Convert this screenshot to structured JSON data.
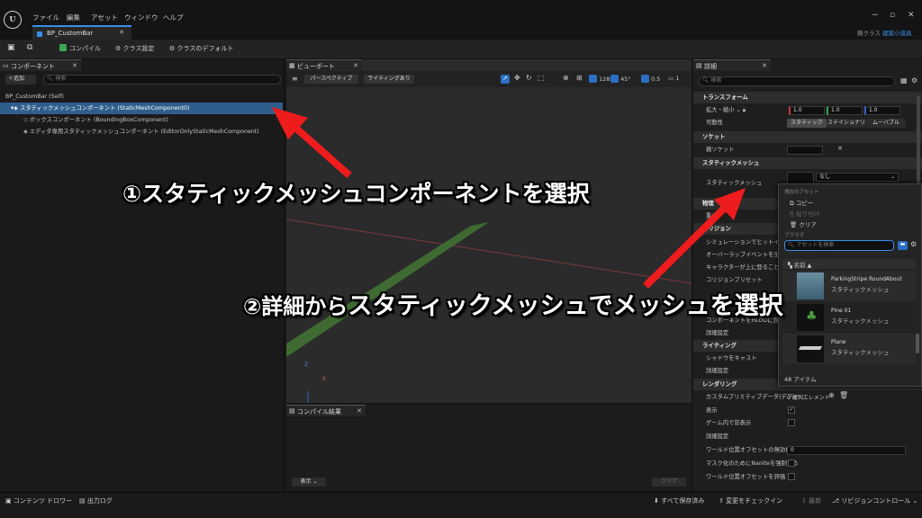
{
  "app": {
    "logo": "U",
    "menu": [
      "ファイル",
      "編集",
      "アセット",
      "ウィンドウ",
      "ヘルプ"
    ],
    "tab": "BP_CustomBar",
    "parent_label": "親クラス",
    "parent_value": "建築小道具",
    "window_controls": {
      "min": "−",
      "max": "▫",
      "close": "✕"
    }
  },
  "toolbar": {
    "compile": "コンパイル",
    "class_settings": "クラス設定",
    "class_defaults": "クラスのデフォルト"
  },
  "components": {
    "tab": "コンポーネント",
    "add": "＋追加",
    "search_placeholder": "検索",
    "tree": [
      "BP_CustomBar (Self)",
      "スタティックメッシュコンポーネント (StaticMeshComponent0)",
      "ボックスコンポーネント (BoundingBoxComponent)",
      "エディタ専用スタティックメッシュコンポーネント (EditorOnlyStaticMeshComponent)"
    ]
  },
  "viewport": {
    "tab": "ビューポート",
    "perspective": "パースペクティブ",
    "lit": "ライティングあり",
    "grid": "128",
    "angle": "45°",
    "scale": "0.5",
    "cam": "1",
    "axis_z": "Z",
    "axis_x": "X"
  },
  "compile_results": {
    "tab": "コンパイル結果",
    "show": "表示 ⌄",
    "clear": "クリア"
  },
  "details": {
    "tab": "詳細",
    "search_placeholder": "検索",
    "transform": "トランスフォーム",
    "scale_label": "拡大・縮小 ⌄",
    "scale_x": "1.0",
    "scale_y": "1.0",
    "scale_z": "1.0",
    "mobility": "可動性",
    "mob_static": "スタティック",
    "mob_stationary": "ステイショナリ",
    "mob_movable": "ムーバブル",
    "socket": "ソケット",
    "parent_socket": "親ソケット",
    "static_mesh_cat": "スタティックメッシュ",
    "static_mesh": "スタティックメッシュ",
    "static_mesh_value": "なし",
    "physics": "物理",
    "physics_sub": "重力",
    "collision": "コリジョン",
    "sim_hit": "シミュレーションでヒットイベント",
    "overlap": "オーバーラップイベントを生成",
    "char_step": "キャラクターが上に登ることがで…",
    "collision_preset": "コリジョンプリセット",
    "hlod": "コンポーネントをHLODに含める",
    "adv1": "詳細設定",
    "lighting": "ライティング",
    "cast_shadow": "シャドウをキャスト",
    "adv2": "詳細設定",
    "rendering": "レンダリング",
    "custom_prim": "カスタムプリミティブデータ(デフォ…",
    "custom_prim_val": "0 配列エレメント",
    "visible": "表示",
    "hidden_game": "ゲーム内で非表示",
    "adv3": "詳細設定",
    "wpo": "ワールド位置オフセットの無効化…",
    "wpo_val": "0",
    "nanite": "マスク化のためにNaniteを強制する",
    "wpo_eval": "ワールド位置オフセットを評価"
  },
  "popup": {
    "current_asset": "現在のアセット",
    "copy": "コピー",
    "paste": "貼り付け",
    "clear": "クリア",
    "browse": "ブラウズ",
    "search_placeholder": "アセットを検索",
    "name_header": "名前 ▲",
    "assets": [
      {
        "name": "ParkingStripe RoundAbout",
        "type": "スタティックメッシュ"
      },
      {
        "name": "Pine 01",
        "type": "スタティックメッシュ"
      },
      {
        "name": "Plane",
        "type": "スタティックメッシュ"
      }
    ],
    "count": "48 アイテム"
  },
  "status": {
    "content_drawer": "コンテンツ ドロワー",
    "output_log": "出力ログ",
    "save_all": "すべて保存済み",
    "checkin": "変更をチェックイン",
    "latest": "最新",
    "revision": "リビジョンコントロール ⌄"
  },
  "annotations": {
    "step1": "①スタティックメッシュコンポーネントを選択",
    "step2_a": "②詳細から",
    "step2_b": "スタティックメッシュで",
    "step2_c": "メッシュを選択"
  },
  "colors": {
    "accent": "#3a8ee6",
    "arrow": "#ee1c1c",
    "selected": "#2f5e8c"
  }
}
